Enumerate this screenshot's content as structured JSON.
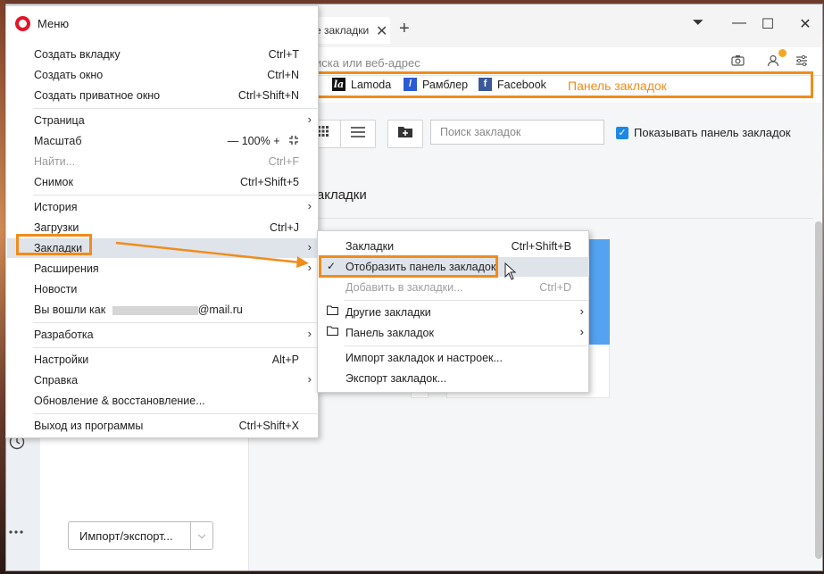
{
  "titlebar": {
    "tab_title": "е закладки",
    "tab_close": "✕",
    "tab_add": "+",
    "controls": {
      "menu": "⏷",
      "minimize": "—",
      "maximize": "☐",
      "close": "✕"
    }
  },
  "addressbar": {
    "placeholder": "иска или веб-адрес"
  },
  "bookmarks_bar": {
    "items": [
      {
        "label": "Lamoda",
        "icon": "la"
      },
      {
        "label": "Рамблер",
        "icon": "/"
      },
      {
        "label": "Facebook",
        "icon": "f"
      }
    ],
    "annotation": "Панель закладок"
  },
  "toolbar": {
    "search_placeholder": "Поиск закладок",
    "show_bar_checkbox": true,
    "show_bar_label": "Показывать панель закладок"
  },
  "main": {
    "section_title": "закладки"
  },
  "leftpanel": {
    "import_export": "Импорт/экспорт...",
    "dropdown": "⌵"
  },
  "menu": {
    "title": "Меню",
    "items": [
      {
        "label": "Создать вкладку",
        "shortcut": "Ctrl+T"
      },
      {
        "label": "Создать окно",
        "shortcut": "Ctrl+N"
      },
      {
        "label": "Создать приватное окно",
        "shortcut": "Ctrl+Shift+N"
      },
      {
        "label": "Страница",
        "shortcut": ""
      },
      {
        "label": "Масштаб",
        "zoom_minus": "—",
        "zoom_value": "100%",
        "zoom_plus": "+"
      },
      {
        "label": "Найти...",
        "shortcut": "Ctrl+F"
      },
      {
        "label": "Снимок",
        "shortcut": "Ctrl+Shift+5"
      },
      {
        "label": "История",
        "shortcut": ""
      },
      {
        "label": "Загрузки",
        "shortcut": "Ctrl+J"
      },
      {
        "label": "Закладки",
        "shortcut": ""
      },
      {
        "label": "Расширения",
        "shortcut": ""
      },
      {
        "label": "Новости",
        "shortcut": ""
      },
      {
        "label": "Вы вошли как",
        "email_suffix": "@mail.ru"
      },
      {
        "label": "Разработка",
        "shortcut": ""
      },
      {
        "label": "Настройки",
        "shortcut": "Alt+P"
      },
      {
        "label": "Справка",
        "shortcut": ""
      },
      {
        "label": "Обновление & восстановление...",
        "shortcut": ""
      },
      {
        "label": "Выход из программы",
        "shortcut": "Ctrl+Shift+X"
      }
    ]
  },
  "submenu": {
    "items": [
      {
        "label": "Закладки",
        "shortcut": "Ctrl+Shift+B"
      },
      {
        "label": "Отобразить панель закладок",
        "shortcut": "",
        "checked": true
      },
      {
        "label": "Добавить в закладки...",
        "shortcut": "Ctrl+D"
      },
      {
        "label": "Другие закладки",
        "shortcut": ""
      },
      {
        "label": "Панель закладок",
        "shortcut": ""
      },
      {
        "label": "Импорт закладок и настроек...",
        "shortcut": ""
      },
      {
        "label": "Экспорт закладок...",
        "shortcut": ""
      }
    ]
  },
  "colors": {
    "highlight": "#f08c1a",
    "accent": "#1e88e5",
    "opera_red": "#e0162b"
  }
}
